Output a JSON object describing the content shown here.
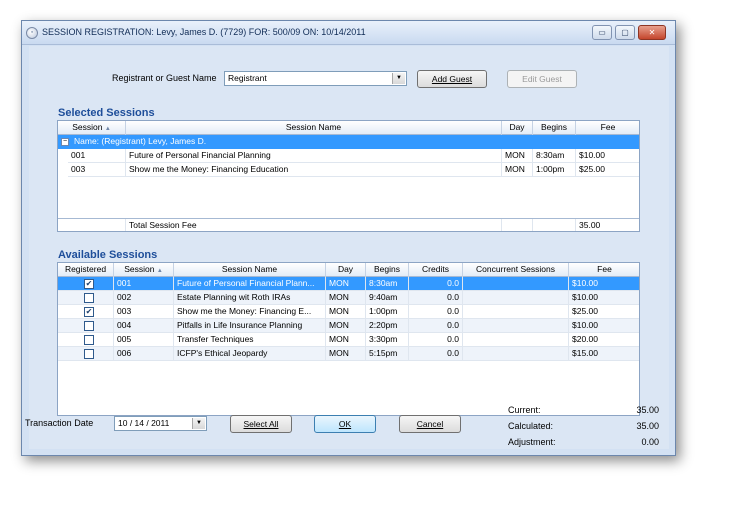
{
  "window": {
    "title": "SESSION REGISTRATION: Levy, James D. (7729) FOR: 500/09 ON: 10/14/2011",
    "minimize_glyph": "▭",
    "maximize_glyph": "▢",
    "close_glyph": "✕"
  },
  "registrant": {
    "label": "Registrant or Guest Name",
    "value": "Registrant",
    "add_guest": "Add Guest",
    "edit_guest": "Edit Guest"
  },
  "selected": {
    "title": "Selected Sessions",
    "headers": [
      "Session",
      "Session Name",
      "Day",
      "Begins",
      "Fee"
    ],
    "group_label": "Name: (Registrant) Levy, James D.",
    "rows": [
      {
        "session": "001",
        "name": "Future of Personal Financial Planning",
        "day": "MON",
        "begins": "8:30am",
        "fee": "$10.00"
      },
      {
        "session": "003",
        "name": "Show me the Money: Financing Education",
        "day": "MON",
        "begins": "1:00pm",
        "fee": "$25.00"
      }
    ],
    "total_label": "Total Session Fee",
    "total_value": "35.00"
  },
  "available": {
    "title": "Available Sessions",
    "headers": [
      "Registered",
      "Session",
      "Session Name",
      "Day",
      "Begins",
      "Credits",
      "Concurrent Sessions",
      "Fee"
    ],
    "rows": [
      {
        "checked": true,
        "session": "001",
        "name": "Future of Personal Financial Plann...",
        "day": "MON",
        "begins": "8:30am",
        "credits": "0.0",
        "concurrent": "",
        "fee": "$10.00"
      },
      {
        "checked": false,
        "session": "002",
        "name": "Estate Planning wit Roth IRAs",
        "day": "MON",
        "begins": "9:40am",
        "credits": "0.0",
        "concurrent": "",
        "fee": "$10.00"
      },
      {
        "checked": true,
        "session": "003",
        "name": "Show me the Money: Financing E...",
        "day": "MON",
        "begins": "1:00pm",
        "credits": "0.0",
        "concurrent": "",
        "fee": "$25.00"
      },
      {
        "checked": false,
        "session": "004",
        "name": "Pitfalls in Life Insurance Planning",
        "day": "MON",
        "begins": "2:20pm",
        "credits": "0.0",
        "concurrent": "",
        "fee": "$10.00"
      },
      {
        "checked": false,
        "session": "005",
        "name": "Transfer Techniques",
        "day": "MON",
        "begins": "3:30pm",
        "credits": "0.0",
        "concurrent": "",
        "fee": "$20.00"
      },
      {
        "checked": false,
        "session": "006",
        "name": "ICFP's Ethical Jeopardy",
        "day": "MON",
        "begins": "5:15pm",
        "credits": "0.0",
        "concurrent": "",
        "fee": "$15.00"
      }
    ]
  },
  "footer": {
    "transaction_label": "Transaction Date",
    "transaction_date": "10 / 14 / 2011",
    "select_all": "Select All",
    "ok": "OK",
    "cancel": "Cancel",
    "current_label": "Current:",
    "current_value": "35.00",
    "calculated_label": "Calculated:",
    "calculated_value": "35.00",
    "adjustment_label": "Adjustment:",
    "adjustment_value": "0.00"
  },
  "icons": {
    "sort": "▲",
    "dropdown": "▼",
    "collapse": "−",
    "check": "✔"
  },
  "colors": {
    "selection": "#3399ff",
    "section_title": "#1e4e9a",
    "window_bg": "#dbe6f4"
  }
}
